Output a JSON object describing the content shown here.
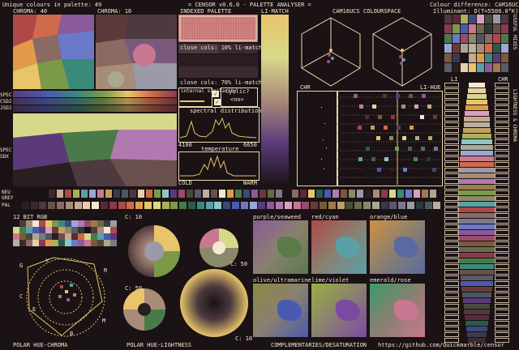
{
  "header": {
    "unique_colours": "Unique colours in palette: 49",
    "title": "= CENSOR v0.6.0 - PALETTE ANALYSER =",
    "colour_difference": "Colour difference: CAM16UCS",
    "illuminant": "Illuminant: D(T=5500.0°K)"
  },
  "panels": {
    "chroma40": "CHROMA: 40",
    "chroma10": "CHROMA: 10",
    "indexed_palette": "INDEXED PALETTE",
    "li_match": "LI-MATCH",
    "cam16ucs": "CAM16UCS COLOURSPACE",
    "close_cols_10": "close cols: 10% li-match",
    "close_cols_70": "close cols: 70% li-match",
    "internal_similarity": "internal similarity",
    "cyclic": "cyclic?",
    "cyclic_value": "<no>",
    "spectral_distribution": "spectral distribution",
    "spectral_min": "4100",
    "spectral_max": "6650",
    "temperature": "temperature",
    "cold": "COLD",
    "warm": "WARM",
    "chr": "CHR",
    "li_hue": "LI-HUE",
    "li": "LI",
    "chr_right": "CHR",
    "useful_mixes": "USEFUL MIXES",
    "lightness_chroma": "LIGHTNESS & CHROMA",
    "spec": "SPEC",
    "csd2": "CSD2",
    "jsd2": "JSD2",
    "spec_sdx": "SPEC SDX",
    "neu": "NEU",
    "grey": "GREY",
    "pal": "PAL",
    "rgb12": "12 BIT RGB",
    "c10_a": "C: 10",
    "c50_a": "C: 50",
    "c50_b": "C: 50",
    "c10_b": "C: 10",
    "polar_hue_chroma": "POLAR HUE-CHROMA",
    "polar_hue_lightness": "POLAR HUE-LIGHTNESS",
    "complementaries": "COMPLEMENTARIES/DESATURATION",
    "github": "https://github.com/Quickmarble/censor",
    "wheel_g": "G",
    "wheel_y": "Y",
    "wheel_r": "R",
    "wheel_c": "C",
    "wheel_m": "M",
    "wheel_b": "B",
    "wheel_e": "E"
  },
  "complementaries": [
    {
      "label": "purple/seaweed",
      "a": "#8a5a9a",
      "b": "#5a7a4a"
    },
    {
      "label": "red/cyan",
      "a": "#b04848",
      "b": "#5aa0a8"
    },
    {
      "label": "orange/blue",
      "a": "#d09040",
      "b": "#5a6aa0"
    },
    {
      "label": "olive/ultramarine",
      "a": "#8a8a40",
      "b": "#4a5ab0"
    },
    {
      "label": "lime/violet",
      "a": "#9ab040",
      "b": "#7a4aa0"
    },
    {
      "label": "emerald/rose",
      "a": "#3a9a6a",
      "b": "#c87890"
    }
  ],
  "palette": [
    "#1a1214",
    "#2a1e22",
    "#3b2a30",
    "#4d3a3e",
    "#6a4f4f",
    "#8a6a62",
    "#a88b78",
    "#c8aa8e",
    "#e8cfa8",
    "#f3e9d0",
    "#5a2a3a",
    "#8a3a4a",
    "#b04848",
    "#d06a4a",
    "#e09a4a",
    "#e8c46a",
    "#d8d88a",
    "#a8b05a",
    "#7a9a4a",
    "#4a7a4a",
    "#2a5a4a",
    "#3a8a7a",
    "#5aa0a8",
    "#8ac8c8",
    "#3a4a7a",
    "#4a5ab0",
    "#6a7ac8",
    "#9aa8d8",
    "#5a3a7a",
    "#8a5a9a",
    "#b07ab0",
    "#d8a0c0",
    "#c87890",
    "#9a4a6a",
    "#6a3a3a",
    "#7a5a3a",
    "#a07a4a",
    "#c0a060",
    "#4a4a3a",
    "#6a6a4a",
    "#8a8a6a",
    "#aaa890",
    "#3a3a4a",
    "#5a5a6a",
    "#7a7a8a",
    "#9a9aa8",
    "#2a3a3a",
    "#4a5a5a",
    "#bab0a0"
  ]
}
